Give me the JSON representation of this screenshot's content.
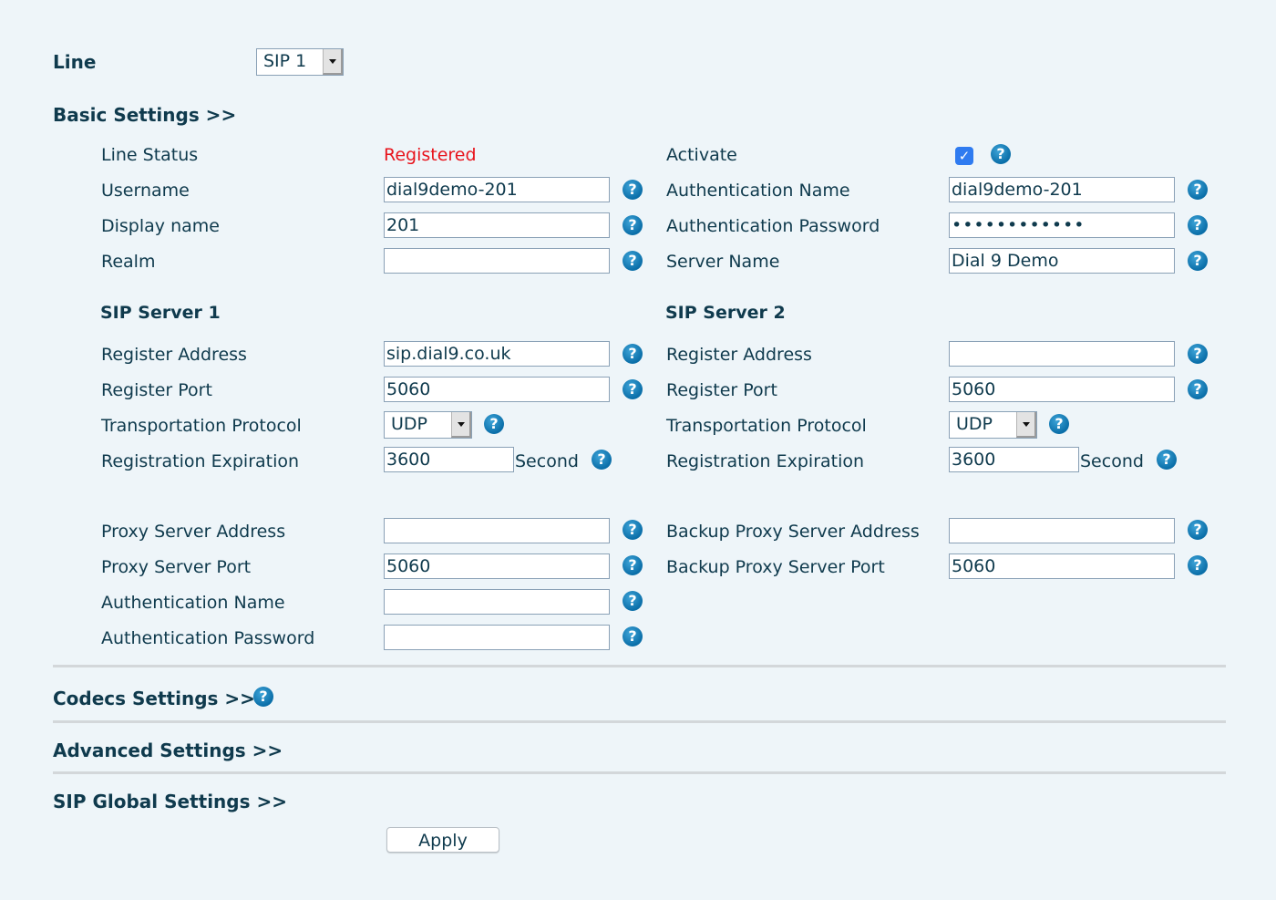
{
  "line": {
    "label": "Line",
    "value": "SIP 1"
  },
  "basic": {
    "title": "Basic Settings >>",
    "line_status_label": "Line Status",
    "line_status_value": "Registered",
    "activate_label": "Activate",
    "activate_checked": true,
    "username_label": "Username",
    "username_value": "dial9demo-201",
    "auth_name_label": "Authentication Name",
    "auth_name_value": "dial9demo-201",
    "display_name_label": "Display name",
    "display_name_value": "201",
    "auth_password_label": "Authentication Password",
    "auth_password_value": "••••••••••••",
    "realm_label": "Realm",
    "realm_value": "",
    "server_name_label": "Server Name",
    "server_name_value": "Dial 9 Demo"
  },
  "sip1": {
    "title": "SIP Server 1",
    "reg_addr_label": "Register Address",
    "reg_addr_value": "sip.dial9.co.uk",
    "reg_port_label": "Register Port",
    "reg_port_value": "5060",
    "transport_label": "Transportation Protocol",
    "transport_value": "UDP",
    "expiration_label": "Registration Expiration",
    "expiration_value": "3600",
    "expiration_unit": "Second"
  },
  "sip2": {
    "title": "SIP Server 2",
    "reg_addr_label": "Register Address",
    "reg_addr_value": "",
    "reg_port_label": "Register Port",
    "reg_port_value": "5060",
    "transport_label": "Transportation Protocol",
    "transport_value": "UDP",
    "expiration_label": "Registration Expiration",
    "expiration_value": "3600",
    "expiration_unit": "Second"
  },
  "proxy": {
    "addr_label": "Proxy Server Address",
    "addr_value": "",
    "port_label": "Proxy Server Port",
    "port_value": "5060",
    "auth_name_label": "Authentication Name",
    "auth_name_value": "",
    "auth_password_label": "Authentication Password",
    "auth_password_value": "",
    "backup_addr_label": "Backup Proxy Server Address",
    "backup_addr_value": "",
    "backup_port_label": "Backup Proxy Server Port",
    "backup_port_value": "5060"
  },
  "sections": {
    "codecs": "Codecs Settings >>",
    "advanced": "Advanced Settings >>",
    "sip_global": "SIP Global Settings >>"
  },
  "help_glyph": "?",
  "check_glyph": "✓",
  "apply_label": "Apply"
}
